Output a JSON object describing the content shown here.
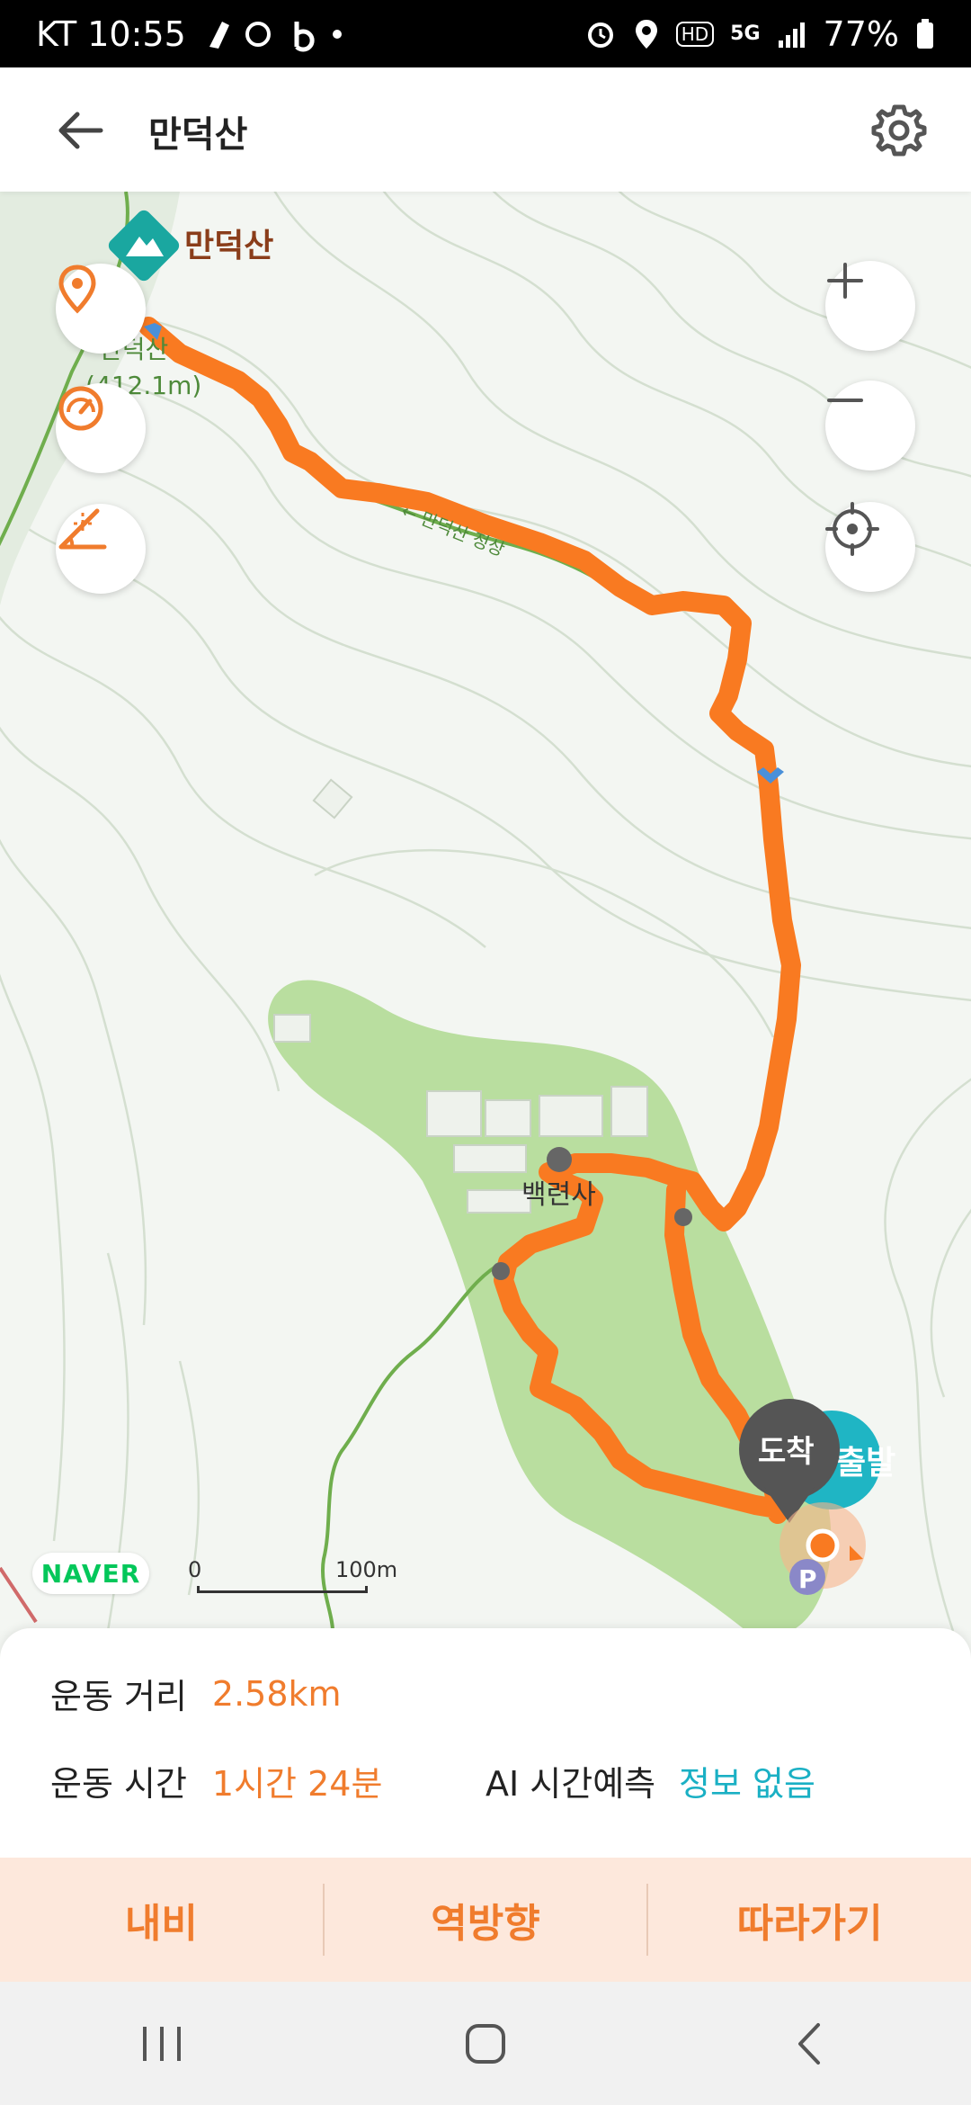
{
  "status_bar": {
    "carrier_time": "KT 10:55",
    "network": "5G",
    "hd": "HD",
    "battery": "77%"
  },
  "header": {
    "title": "만덕산",
    "back_icon": "arrow-left-icon",
    "settings_icon": "gear-icon"
  },
  "map": {
    "peak_name": "만덕산",
    "peak_sub_name": "만덕산",
    "peak_elevation": "(412.1m)",
    "temple_name": "백련사",
    "start_badge": "출발",
    "end_badge": "도착",
    "parking": "P",
    "trail_text": "← 만덕산 정상",
    "provider_logo": "NAVER",
    "scale_start": "0",
    "scale_end": "100m",
    "colors": {
      "route": "#f97a21",
      "park": "#b6dca0",
      "contour": "#cfdccb",
      "trail": "#6fae4d"
    }
  },
  "info": {
    "distance_label": "운동 거리",
    "distance_value": "2.58km",
    "time_label": "운동 시간",
    "time_value": "1시간 24분",
    "ai_label": "AI 시간예측",
    "ai_value": "정보 없음"
  },
  "actions": {
    "navi": "내비",
    "reverse": "역방향",
    "follow": "따라가기"
  },
  "colors": {
    "accent": "#f07c2d",
    "teal": "#1ab0c4",
    "action_bg": "#fde8dc"
  }
}
